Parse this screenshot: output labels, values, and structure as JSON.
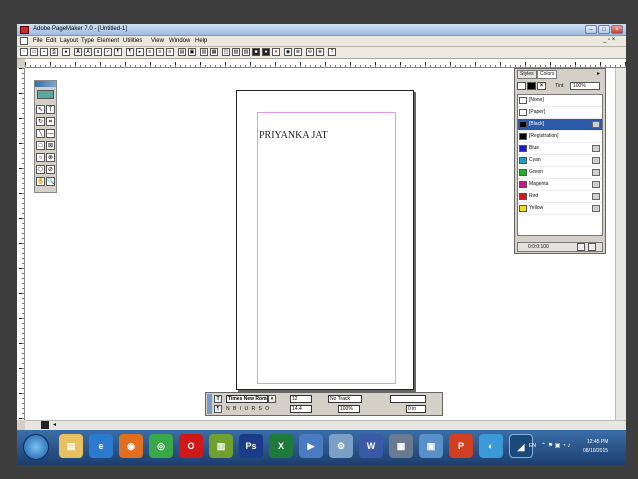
{
  "window": {
    "title": "Adobe PageMaker 7.0 - [Untitled-1]"
  },
  "menus": [
    "File",
    "Edit",
    "Layout",
    "Type",
    "Element",
    "Utilities",
    "View",
    "Window",
    "Help"
  ],
  "page": {
    "text": "PRIYANKA JAT"
  },
  "colors_palette": {
    "tabs": [
      "Styles",
      "Colors"
    ],
    "tint_label": "Tint:",
    "tint_value": "100%",
    "items": [
      {
        "name": "[None]",
        "color": "#ffffff",
        "selected": false
      },
      {
        "name": "[Paper]",
        "color": "#ffffff",
        "selected": false
      },
      {
        "name": "[Black]",
        "color": "#000000",
        "selected": true
      },
      {
        "name": "[Registration]",
        "color": "#000000",
        "selected": false
      },
      {
        "name": "Blue",
        "color": "#1a1acc",
        "selected": false
      },
      {
        "name": "Cyan",
        "color": "#18a0c8",
        "selected": false
      },
      {
        "name": "Green",
        "color": "#22b022",
        "selected": false
      },
      {
        "name": "Magenta",
        "color": "#c01890",
        "selected": false
      },
      {
        "name": "Red",
        "color": "#d01818",
        "selected": false
      },
      {
        "name": "Yellow",
        "color": "#f0e020",
        "selected": false
      }
    ],
    "footer": "0:0:0:100"
  },
  "control_palette": {
    "font": "Times New Roman",
    "size": "12",
    "leading": "14.4",
    "track": "No Track",
    "scale": "100%",
    "kern": "0 in"
  },
  "taskbar": {
    "lang": "EN",
    "time": "12:45 PM",
    "date": "08/10/2015"
  },
  "accent_colors": {
    "titlebar": "#9fbbe0",
    "taskbar": "#1c3e6e",
    "margin_guide": "#e09ae8"
  }
}
